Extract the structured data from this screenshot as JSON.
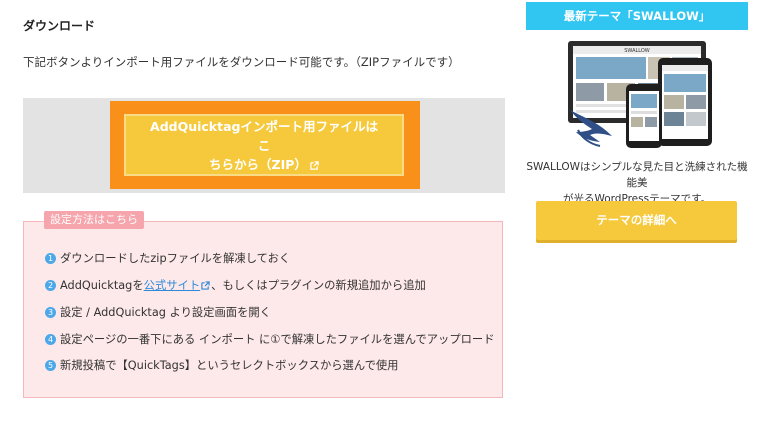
{
  "download": {
    "heading": "ダウンロード",
    "description": "下記ボタンよりインポート用ファイルをダウンロード可能です。（ZIPファイルです）",
    "button_line1": "AddQuicktagインポート用ファイルはこ",
    "button_line2": "ちらから（ZIP）"
  },
  "steps": {
    "tag": "設定方法はこちら",
    "items": [
      {
        "num": "1",
        "text": "ダウンロードしたzipファイルを解凍しておく"
      },
      {
        "num": "2",
        "text_before": "AddQuicktagを",
        "link": "公式サイト",
        "text_after": "、もしくはプラグインの新規追加から追加"
      },
      {
        "num": "3",
        "text": "設定 / AddQuicktag より設定画面を開く"
      },
      {
        "num": "4",
        "text": "設定ページの一番下にある インポート に①で解凍したファイルを選んでアップロード"
      },
      {
        "num": "5",
        "text": "新規投稿で【QuickTags】というセレクトボックスから選んで使用"
      }
    ]
  },
  "sidebar": {
    "header": "最新テーマ「SWALLOW」",
    "mockup_title": "SWALLOW",
    "description_line1": "SWALLOWはシンプルな見た目と洗練された機能美",
    "description_line2": "が光るWordPressテーマです。",
    "button": "テーマの詳細へ"
  },
  "colors": {
    "accent_yellow": "#f5c93b",
    "frame_orange": "#f9901a",
    "header_cyan": "#31c5f2",
    "steps_pink": "#fde8ea",
    "step_blue": "#4ca8e8"
  }
}
